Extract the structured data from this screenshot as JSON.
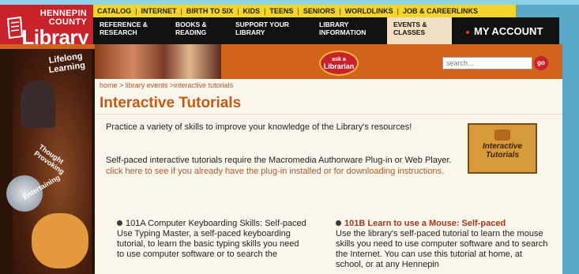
{
  "logo": {
    "line1": "HENNEPIN",
    "line2": "COUNTY",
    "line3": "Library"
  },
  "top_links": [
    "CATALOG",
    "INTERNET",
    "BIRTH TO SIX",
    "KIDS",
    "TEENS",
    "SENIORS",
    "WORLDLINKS",
    "JOB & CAREERLINKS"
  ],
  "nav": {
    "items": [
      {
        "line1": "REFERENCE &",
        "line2": "RESEARCH"
      },
      {
        "line1": "BOOKS &",
        "line2": "READING"
      },
      {
        "line1": "SUPPORT YOUR",
        "line2": "LIBRARY"
      },
      {
        "line1": "LIBRARY",
        "line2": "INFORMATION"
      }
    ],
    "active": {
      "line1": "EVENTS &",
      "line2": "CLASSES"
    },
    "account": "MY ACCOUNT"
  },
  "banner": {
    "lifelong": "Lifelong Learning",
    "ask_line1": "ask a",
    "ask_line2": "Librarian",
    "search_placeholder": "search...",
    "go_label": "go"
  },
  "art": {
    "thought": "Thought Provoking",
    "entertaining": "Entertaining"
  },
  "breadcrumb": "home > library events >interactive tutorials",
  "title": "Interactive Tutorials",
  "intro": "Practice a variety of skills to improve your knowledge of the Library's resources!",
  "plugin_text": "Self-paced interactive tutorials require the Macromedia Authorware Plug-in or Web Player.",
  "plugin_link": "click here to see if you already have the plug-in installed or for downloading instructions.",
  "tutorial_icon": "Interactive Tutorials",
  "tutorials": [
    {
      "title": "101A Computer Keyboarding Skills: Self-paced",
      "desc": "Use Typing Master, a self-paced keyboarding tutorial, to learn the basic typing skills you need to use computer software or to search the"
    },
    {
      "title": "101B Learn to use a Mouse: Self-paced",
      "desc": "Use the library's self-paced tutorial to learn the mouse skills you need to use computer software and to search the Internet. You can use this tutorial at home, at school, or at any Hennepin"
    }
  ],
  "colors": {
    "brand_red": "#c8232c",
    "banner_orange": "#d2631d",
    "title_orange": "#c25b14",
    "nav_black": "#111111",
    "toplink_yellow": "#f5d52a"
  },
  "icons": {
    "logo_mark": "library-logo-icon",
    "go": "go-button-icon",
    "bullet": "bullet-icon"
  }
}
